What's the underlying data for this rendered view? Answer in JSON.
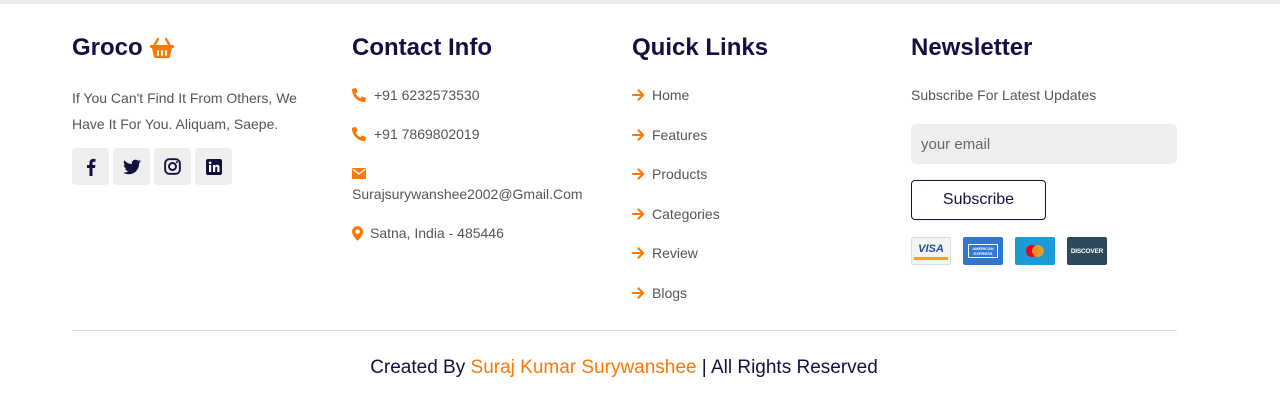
{
  "colors": {
    "accent": "#ff7800",
    "dark": "#130f40",
    "text": "#555555",
    "bg_light": "#eeeeee"
  },
  "brand": {
    "name": "Groco",
    "icon": "basket-icon",
    "about": "If You Can't Find It From Others, We Have It For You. Aliquam, Saepe."
  },
  "social": [
    {
      "name": "facebook",
      "icon": "facebook-icon"
    },
    {
      "name": "twitter",
      "icon": "twitter-icon"
    },
    {
      "name": "instagram",
      "icon": "instagram-icon"
    },
    {
      "name": "linkedin",
      "icon": "linkedin-icon"
    }
  ],
  "contact": {
    "title": "Contact Info",
    "phone1": "+91 6232573530",
    "phone2": "+91 7869802019",
    "email": "Surajsurywanshee2002@Gmail.Com",
    "address": "Satna, India - 485446"
  },
  "quick_links": {
    "title": "Quick Links",
    "items": [
      "Home",
      "Features",
      "Products",
      "Categories",
      "Review",
      "Blogs"
    ]
  },
  "newsletter": {
    "title": "Newsletter",
    "text": "Subscribe For Latest Updates",
    "placeholder": "your email",
    "button": "Subscribe",
    "cards": [
      "VISA",
      "AMERICAN EXPRESS",
      "mastercard",
      "DISCOVER"
    ]
  },
  "credit": {
    "prefix": "Created By ",
    "author": "Suraj Kumar Surywanshee",
    "suffix": " | All Rights Reserved"
  }
}
